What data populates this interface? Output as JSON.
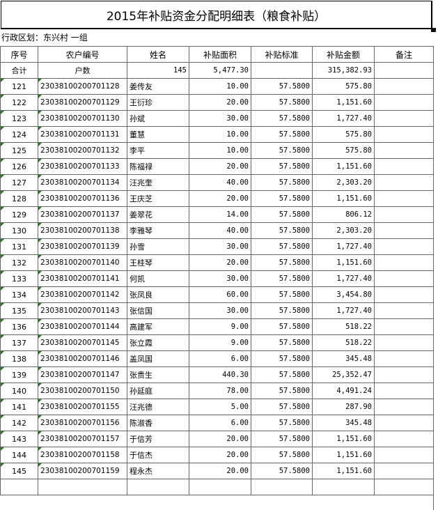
{
  "title": "2015年补贴资金分配明细表（粮食补贴）",
  "region_label": "行政区划：东兴村  一组",
  "headers": [
    "序号",
    "农户编号",
    "姓名",
    "补贴面积",
    "补贴标准",
    "补贴金额",
    "备注"
  ],
  "summary": {
    "label": "合计",
    "households_label": "户数",
    "households": "145",
    "area": "5,477.30",
    "amount": "315,382.93"
  },
  "rows": [
    {
      "no": "121",
      "code": "23038100200701128",
      "name": "姜传友",
      "area": "10.00",
      "rate": "57.5800",
      "amount": "575.80"
    },
    {
      "no": "122",
      "code": "23038100200701129",
      "name": "王衍珍",
      "area": "20.00",
      "rate": "57.5800",
      "amount": "1,151.60"
    },
    {
      "no": "123",
      "code": "23038100200701130",
      "name": "孙斌",
      "area": "30.00",
      "rate": "57.5800",
      "amount": "1,727.40"
    },
    {
      "no": "124",
      "code": "23038100200701131",
      "name": "董慧",
      "area": "10.00",
      "rate": "57.5800",
      "amount": "575.80"
    },
    {
      "no": "125",
      "code": "23038100200701132",
      "name": "李平",
      "area": "10.00",
      "rate": "57.5800",
      "amount": "575.80"
    },
    {
      "no": "126",
      "code": "23038100200701133",
      "name": "陈福禄",
      "area": "20.00",
      "rate": "57.5800",
      "amount": "1,151.60"
    },
    {
      "no": "127",
      "code": "23038100200701134",
      "name": "汪兆奎",
      "area": "40.00",
      "rate": "57.5800",
      "amount": "2,303.20"
    },
    {
      "no": "128",
      "code": "23038100200701136",
      "name": "王庆芝",
      "area": "20.00",
      "rate": "57.5800",
      "amount": "1,151.60"
    },
    {
      "no": "129",
      "code": "23038100200701137",
      "name": "姜翠花",
      "area": "14.00",
      "rate": "57.5800",
      "amount": "806.12"
    },
    {
      "no": "130",
      "code": "23038100200701138",
      "name": "李雅琴",
      "area": "40.00",
      "rate": "57.5800",
      "amount": "2,303.20"
    },
    {
      "no": "131",
      "code": "23038100200701139",
      "name": "孙雪",
      "area": "30.00",
      "rate": "57.5800",
      "amount": "1,727.40"
    },
    {
      "no": "132",
      "code": "23038100200701140",
      "name": "王桂琴",
      "area": "20.00",
      "rate": "57.5800",
      "amount": "1,151.60"
    },
    {
      "no": "133",
      "code": "23038100200701141",
      "name": "何凯",
      "area": "30.00",
      "rate": "57.5800",
      "amount": "1,727.40"
    },
    {
      "no": "134",
      "code": "23038100200701142",
      "name": "张凤良",
      "area": "60.00",
      "rate": "57.5800",
      "amount": "3,454.80"
    },
    {
      "no": "135",
      "code": "23038100200701143",
      "name": "张信国",
      "area": "30.00",
      "rate": "57.5800",
      "amount": "1,727.40"
    },
    {
      "no": "136",
      "code": "23038100200701144",
      "name": "高建军",
      "area": "9.00",
      "rate": "57.5800",
      "amount": "518.22"
    },
    {
      "no": "137",
      "code": "23038100200701145",
      "name": "张立霞",
      "area": "9.00",
      "rate": "57.5800",
      "amount": "518.22"
    },
    {
      "no": "138",
      "code": "23038100200701146",
      "name": "盖凤国",
      "area": "6.00",
      "rate": "57.5800",
      "amount": "345.48"
    },
    {
      "no": "139",
      "code": "23038100200701147",
      "name": "张贵生",
      "area": "440.30",
      "rate": "57.5800",
      "amount": "25,352.47"
    },
    {
      "no": "140",
      "code": "23038100200701150",
      "name": "孙延庭",
      "area": "78.00",
      "rate": "57.5800",
      "amount": "4,491.24"
    },
    {
      "no": "141",
      "code": "23038100200701155",
      "name": "汪兆德",
      "area": "5.00",
      "rate": "57.5800",
      "amount": "287.90"
    },
    {
      "no": "142",
      "code": "23038100200701156",
      "name": "陈淑香",
      "area": "6.00",
      "rate": "57.5800",
      "amount": "345.48"
    },
    {
      "no": "143",
      "code": "23038100200701157",
      "name": "于信芳",
      "area": "20.00",
      "rate": "57.5800",
      "amount": "1,151.60"
    },
    {
      "no": "144",
      "code": "23038100200701158",
      "name": "于信杰",
      "area": "20.00",
      "rate": "57.5800",
      "amount": "1,151.60"
    },
    {
      "no": "145",
      "code": "23038100200701159",
      "name": "程永杰",
      "area": "20.00",
      "rate": "57.5800",
      "amount": "1,151.60"
    }
  ]
}
